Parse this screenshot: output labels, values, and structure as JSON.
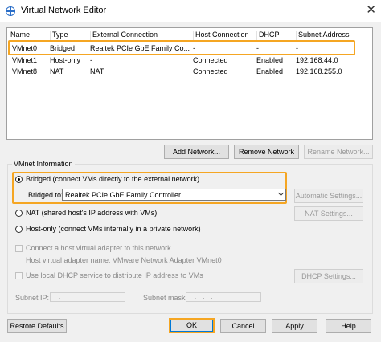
{
  "window": {
    "title": "Virtual Network Editor",
    "close": "✕"
  },
  "table": {
    "headers": [
      "Name",
      "Type",
      "External Connection",
      "Host Connection",
      "DHCP",
      "Subnet Address"
    ],
    "rows": [
      [
        "VMnet0",
        "Bridged",
        "Realtek PCIe GbE Family Co...",
        "-",
        "-",
        "-"
      ],
      [
        "VMnet1",
        "Host-only",
        "-",
        "Connected",
        "Enabled",
        "192.168.44.0"
      ],
      [
        "VMnet8",
        "NAT",
        "NAT",
        "Connected",
        "Enabled",
        "192.168.255.0"
      ]
    ]
  },
  "network_buttons": {
    "add": "Add Network...",
    "remove": "Remove Network",
    "rename": "Rename Network..."
  },
  "vmnet_info": {
    "title": "VMnet Information",
    "bridged_label": "Bridged (connect VMs directly to the external network)",
    "bridged_to_label": "Bridged to:",
    "bridged_to_value": "Realtek PCIe GbE Family Controller",
    "auto_settings": "Automatic Settings...",
    "nat_label": "NAT (shared host's IP address with VMs)",
    "nat_settings": "NAT Settings...",
    "hostonly_label": "Host-only (connect VMs internally in a private network)",
    "connect_adapter_label": "Connect a host virtual adapter to this network",
    "adapter_name_label": "Host virtual adapter name: VMware Network Adapter VMnet0",
    "dhcp_label": "Use local DHCP service to distribute IP address to VMs",
    "dhcp_settings": "DHCP Settings...",
    "subnet_ip_label": "Subnet IP:",
    "subnet_mask_label": "Subnet mask:"
  },
  "footer": {
    "restore": "Restore Defaults",
    "ok": "OK",
    "cancel": "Cancel",
    "apply": "Apply",
    "help": "Help"
  },
  "colors": {
    "highlight": "#f5a623",
    "focus": "#0078d7"
  },
  "icons": {
    "app": "network-globe-icon",
    "close": "close-icon",
    "dropdown": "chevron-down-icon"
  }
}
